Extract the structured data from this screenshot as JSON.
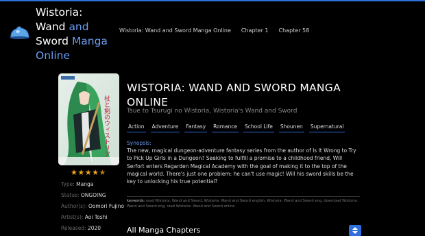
{
  "site": {
    "title_parts": [
      "Wistoria:",
      "Wand",
      "and",
      "Sword",
      "Manga",
      "Online"
    ],
    "logo_icon": "slime-logo-icon",
    "accent": "#2f6fdc"
  },
  "nav": {
    "items": [
      "Wistoria: Wand and Sword Manga Online",
      "Chapter 1",
      "Chapter 58"
    ]
  },
  "manga": {
    "title": "WISTORIA: WAND AND SWORD MANGA ONLINE",
    "alt_titles": "Tsue to Tsurugi no Wistoria, Wistoria's Wand and Sword",
    "genres": [
      "Action",
      "Adventure",
      "Fantasy",
      "Romance",
      "School Life",
      "Shounen",
      "Supernatural"
    ],
    "synopsis_label": "Synopsis:",
    "synopsis": "The new, magical dungeon-adventure fantasy series from the author of Is It Wrong to Try to Pick Up Girls in a Dungeon? Seeking to fulfill a promise to a childhood friend, Will Serfort enters Regarden Magical Academy with the goal of making it to the top of the magical world. There's just one problem: he can't use magic! Will his sword skills be the key to unlocking his true potential?",
    "keywords_label": "keywords:",
    "keywords": "read Wistoria: Wand and Sword, Wistoria: Wand and Sword english, Wistoria: Wand and Sword eng, download Wistoria: Wand and Sword eng, read Wistoria: Wand and Sword online",
    "rating": 4.5,
    "cover_text": "杖と剣のウィストリア",
    "details": [
      {
        "key": "Type:",
        "value": "Manga"
      },
      {
        "key": "Status:",
        "value": "ONGOING"
      },
      {
        "key": "Author(s):",
        "value": "Oomori Fujino"
      },
      {
        "key": "Artist(s):",
        "value": "Aoi Toshi"
      },
      {
        "key": "Released:",
        "value": "2020"
      }
    ]
  },
  "chapters": {
    "heading": "All Manga Chapters",
    "sort_icon": "sort-icon"
  }
}
